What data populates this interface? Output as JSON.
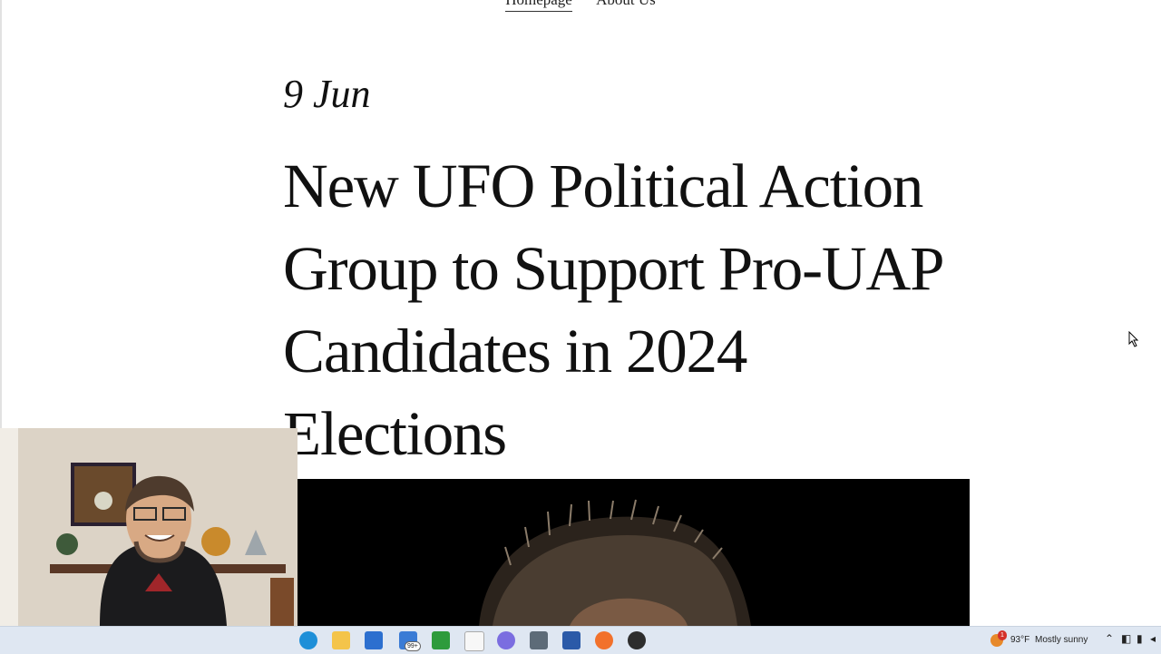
{
  "nav": {
    "items": [
      "Homepage",
      "About Us"
    ],
    "active_index": 0
  },
  "article": {
    "date": "9 Jun",
    "title": "New UFO Political Action Group to Support Pro-UAP Candidates in 2024 Elections"
  },
  "taskbar": {
    "pinned_icons": [
      "edge-icon",
      "file-explorer-icon",
      "microsoft-store-icon",
      "mail-icon",
      "xbox-icon",
      "notepad-icon",
      "snipping-tool-icon",
      "calculator-icon",
      "word-icon",
      "firefox-icon",
      "obs-icon"
    ],
    "mail_badge": "99+",
    "weather": {
      "alert_count": "1",
      "temperature": "93°F",
      "condition": "Mostly sunny"
    }
  },
  "colors": {
    "text": "#111111",
    "taskbar_bg": "#dfe7f2",
    "hero_bg": "#000000"
  }
}
